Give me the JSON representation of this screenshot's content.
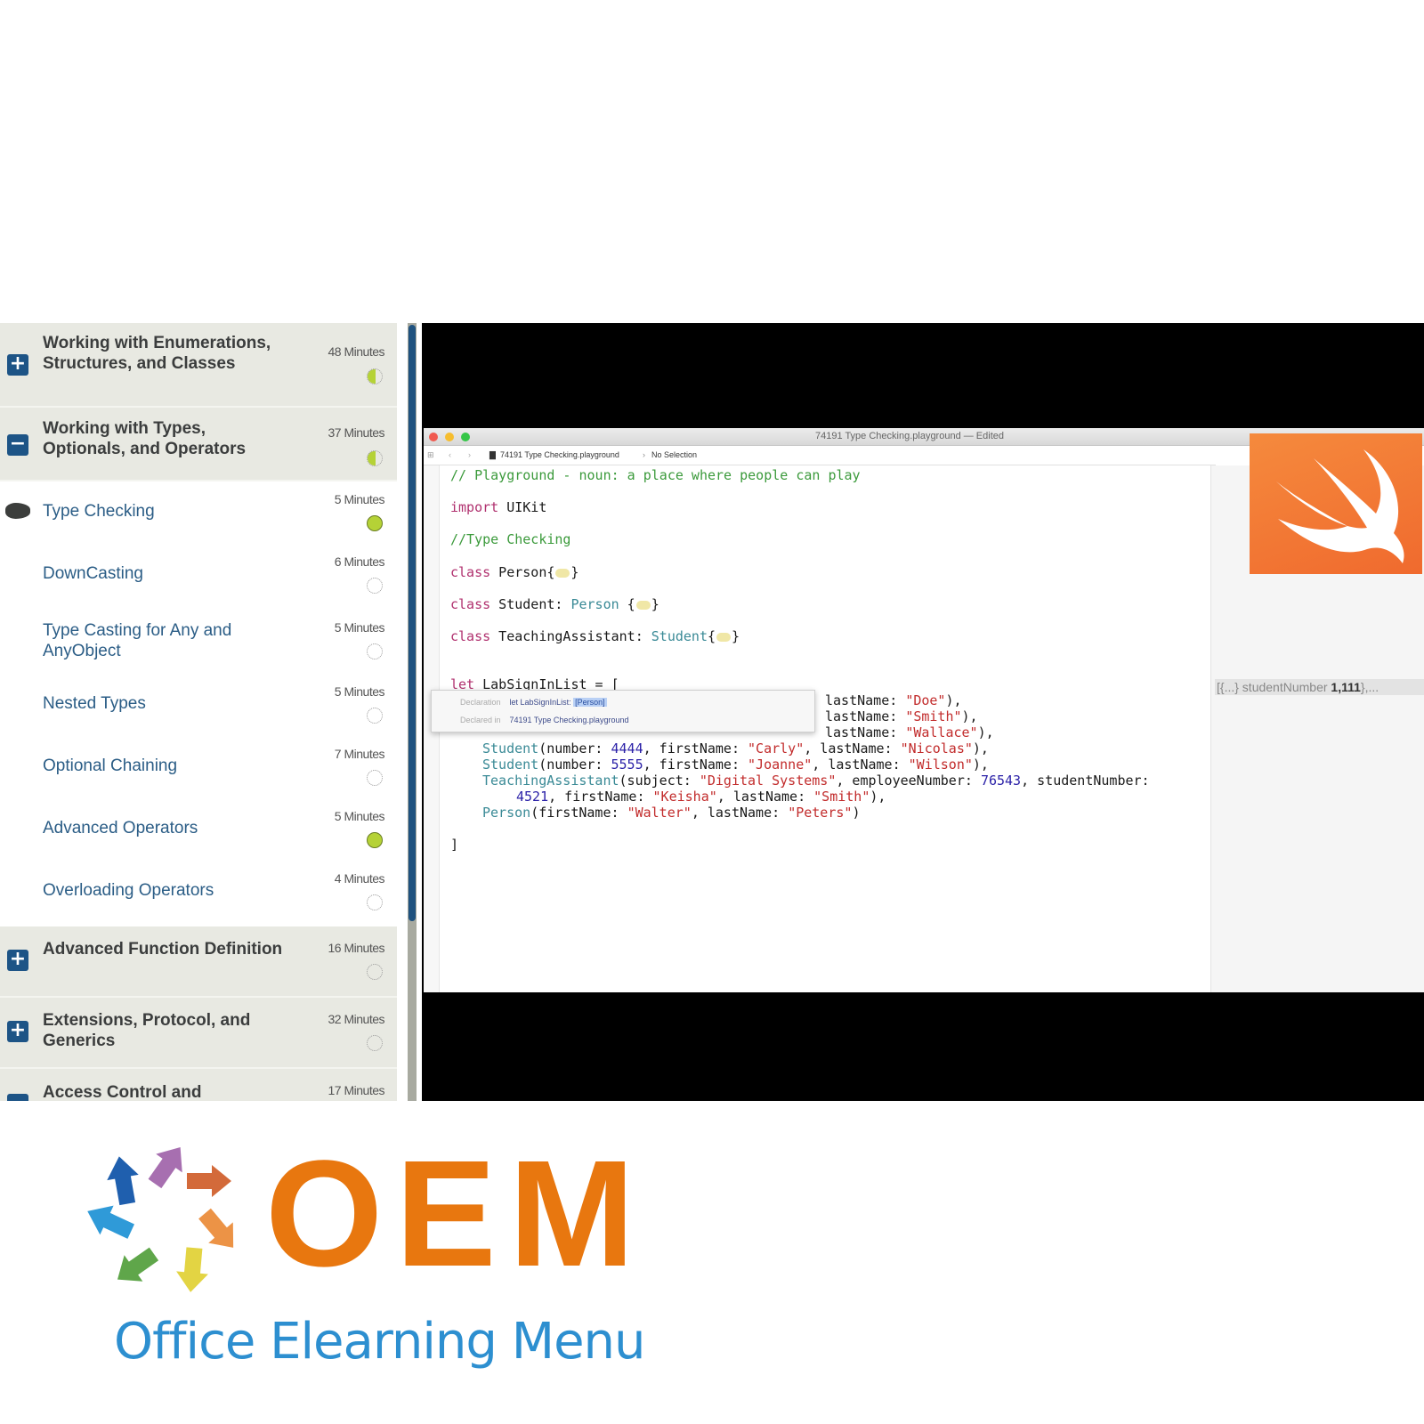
{
  "sidebar": {
    "sections": [
      {
        "title": "Working with Enumerations, Structures, and Classes",
        "duration": "48 Minutes",
        "toggle": "+",
        "toggle_icon": "plus-icon",
        "status": "half"
      },
      {
        "title": "Working with Types, Optionals, and Operators",
        "duration": "37 Minutes",
        "toggle": "−",
        "toggle_icon": "minus-icon",
        "status": "half"
      },
      {
        "title": "Advanced Function Definition",
        "duration": "16 Minutes",
        "toggle": "+",
        "toggle_icon": "plus-icon",
        "status": "none"
      },
      {
        "title": "Extensions, Protocol, and Generics",
        "duration": "32 Minutes",
        "toggle": "+",
        "toggle_icon": "plus-icon",
        "status": "none"
      },
      {
        "title": "Access Control and",
        "duration": "17 Minutes",
        "toggle": "−",
        "toggle_icon": "minus-icon",
        "status": "none"
      }
    ],
    "lessons": [
      {
        "title": "Type Checking",
        "duration": "5 Minutes",
        "status": "done",
        "current": true
      },
      {
        "title": "DownCasting",
        "duration": "6 Minutes",
        "status": "none",
        "current": false
      },
      {
        "title": "Type Casting for Any and AnyObject",
        "duration": "5 Minutes",
        "status": "none",
        "current": false
      },
      {
        "title": "Nested Types",
        "duration": "5 Minutes",
        "status": "none",
        "current": false
      },
      {
        "title": "Optional Chaining",
        "duration": "7 Minutes",
        "status": "none",
        "current": false
      },
      {
        "title": "Advanced Operators",
        "duration": "5 Minutes",
        "status": "done",
        "current": false
      },
      {
        "title": "Overloading Operators",
        "duration": "4 Minutes",
        "status": "none",
        "current": false
      }
    ]
  },
  "video": {
    "window_title": "74191 Type Checking.playground — Edited",
    "breadcrumb_file": "74191 Type Checking.playground",
    "breadcrumb_sep": "›",
    "breadcrumb_selection": "No Selection",
    "code": {
      "comment1": "// Playground - noun: a place where people can play",
      "import_kw": "import",
      "import_mod": " UIKit",
      "comment2": "//Type Checking",
      "class_kw": "class",
      "person_decl": " Person{",
      "student_decl": " Student: ",
      "student_super": "Person",
      "student_brace": " {",
      "ta_decl": " TeachingAssistant: ",
      "ta_super": "Student",
      "ta_brace": "{",
      "close_brace": "}",
      "let_kw": "let",
      "let_rest": " LabSignInList = [",
      "row1_tail": "lastName: ",
      "row1_str": "\"Doe\"",
      "row1_end": "),",
      "row2_str": "\"Smith\"",
      "row3_str": "\"Wallace\"",
      "row4_type": "Student",
      "row4_a": "(number: ",
      "row4_num": "4444",
      "row4_b": ", firstName: ",
      "row4_fn": "\"Carly\"",
      "row4_c": ", lastName: ",
      "row4_ln": "\"Nicolas\"",
      "row5_num": "5555",
      "row5_fn": "\"Joanne\"",
      "row5_ln": "\"Wilson\"",
      "row6_type": "TeachingAssistant",
      "row6_a": "(subject: ",
      "row6_subj": "\"Digital Systems\"",
      "row6_b": ", employeeNumber: ",
      "row6_emp": "76543",
      "row6_c": ", studentNumber:",
      "row7_num": "4521",
      "row7_a": ", firstName: ",
      "row7_fn": "\"Keisha\"",
      "row7_b": ", lastName: ",
      "row7_ln": "\"Smith\"",
      "row7_end": "),",
      "row8_type": "Person",
      "row8_a": "(firstName: ",
      "row8_fn": "\"Walter\"",
      "row8_b": ", lastName: ",
      "row8_ln": "\"Peters\"",
      "row8_end": ")",
      "end_bracket": "]"
    },
    "tooltip": {
      "declaration_label": "Declaration",
      "declaration_value": "let LabSignInList:",
      "declaration_type": "[Person]",
      "declared_label": "Declared in",
      "declared_value": "74191 Type Checking.playground"
    },
    "result_prefix": "[{...} studentNumber ",
    "result_value": "1,111",
    "result_suffix": "},..."
  },
  "branding": {
    "logo_text": "OEM",
    "tagline": "Office Elearning Menu",
    "colors": {
      "orange": "#e8770f",
      "blue": "#2d8fd0",
      "sidebar_toggle": "#1d5486",
      "status_done": "#b5d236",
      "swift_orange": "#f06a2e"
    }
  }
}
